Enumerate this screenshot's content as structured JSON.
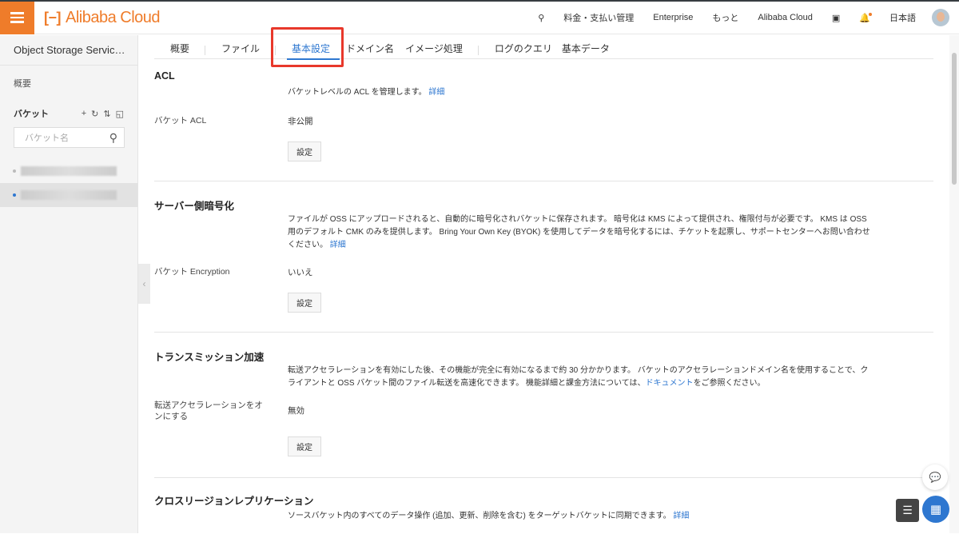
{
  "header": {
    "brand": "Alibaba Cloud",
    "nav": [
      "料金・支払い管理",
      "Enterprise",
      "もっと",
      "Alibaba Cloud"
    ],
    "language": "日本語"
  },
  "sidebar": {
    "title": "Object Storage Servic…",
    "overview": "概要",
    "buckets_label": "バケット",
    "search_placeholder": "バケット名"
  },
  "tabs": [
    {
      "label": "概要"
    },
    {
      "label": "ファイル"
    },
    {
      "label": "基本設定",
      "active": true
    },
    {
      "label": "ドメイン名"
    },
    {
      "label": "イメージ処理"
    },
    {
      "label": "ログのクエリ"
    },
    {
      "label": "基本データ"
    }
  ],
  "sections": {
    "acl": {
      "title": "ACL",
      "desc": "バケットレベルの ACL を管理します。",
      "link": "詳細",
      "label": "バケット ACL",
      "value": "非公開",
      "button": "設定"
    },
    "encryption": {
      "title": "サーバー側暗号化",
      "desc": "ファイルが OSS にアップロードされると、自動的に暗号化されバケットに保存されます。 暗号化は KMS によって提供され、権限付与が必要です。 KMS は OSS 用のデフォルト CMK のみを提供します。 Bring Your Own Key (BYOK) を使用してデータを暗号化するには、チケットを起票し、サポートセンターへお問い合わせください。",
      "link": "詳細",
      "label": "バケット Encryption",
      "value": "いいえ",
      "button": "設定"
    },
    "transfer": {
      "title": "トランスミッション加速",
      "desc": "転送アクセラレーションを有効にした後、その機能が完全に有効になるまで約 30 分かかります。 バケットのアクセラレーションドメイン名を使用することで、クライアントと OSS バケット間のファイル転送を高速化できます。 機能詳細と課金方法については、",
      "link": "ドキュメント",
      "desc_after": "をご参照ください。",
      "label": "転送アクセラレーションをオンにする",
      "value": "無効",
      "button": "設定"
    },
    "replication": {
      "title": "クロスリージョンレプリケーション",
      "desc": "ソースバケット内のすべてのデータ操作 (追加、更新、削除を含む) をターゲットバケットに同期できます。",
      "link": "詳細"
    }
  },
  "colors": {
    "brand": "#ef7c2a",
    "accent": "#2e77d0",
    "highlight": "#e8382b"
  }
}
